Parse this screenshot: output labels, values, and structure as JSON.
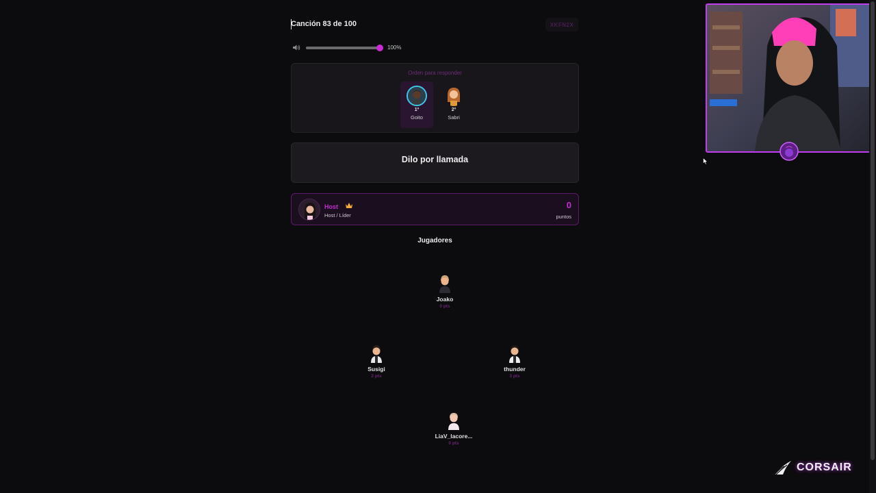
{
  "header": {
    "song_progress": "Canción 83 de 100",
    "room_code": "XKFN2X"
  },
  "volume": {
    "label": "100%",
    "level": 1.0,
    "accent": "#c92bd6"
  },
  "order": {
    "title": "Orden para responder",
    "entries": [
      {
        "rank": "1º",
        "name": "Goito",
        "active": true
      },
      {
        "rank": "2º",
        "name": "Sabri",
        "active": false
      }
    ]
  },
  "call": {
    "text": "Dilo por llamada"
  },
  "host": {
    "name": "Host",
    "role": "Host / Líder",
    "points": "0",
    "points_label": "puntos",
    "icon": "crown-icon"
  },
  "players": {
    "title": "Jugadores",
    "list": [
      {
        "name": "Joako",
        "score": "0 pts"
      },
      {
        "name": "Susigi",
        "score": "2 pts"
      },
      {
        "name": "thunder",
        "score": "3 pts"
      },
      {
        "name": "LiaV_lacore...",
        "score": "0 pts"
      }
    ]
  },
  "overlay": {
    "sponsor": "CORSAIR",
    "accent": "#c23cf0"
  }
}
